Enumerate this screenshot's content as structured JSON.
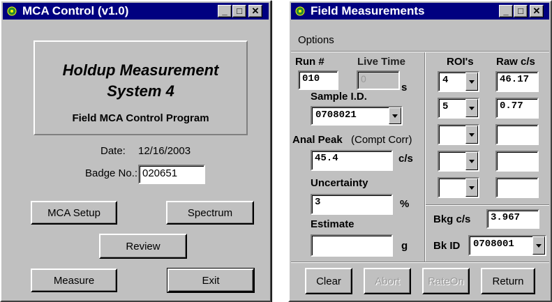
{
  "mca": {
    "title": "MCA Control (v1.0)",
    "banner_line1": "Holdup Measurement",
    "banner_line2": "System 4",
    "banner_sub": "Field MCA Control Program",
    "date_label": "Date:",
    "date_value": "12/16/2003",
    "badge_label": "Badge No.:",
    "badge_value": "020651",
    "buttons": {
      "mca_setup": "MCA Setup",
      "spectrum": "Spectrum",
      "review": "Review",
      "measure": "Measure",
      "exit": "Exit"
    }
  },
  "field": {
    "title": "Field Measurements",
    "menu_options": "Options",
    "run_label": "Run #",
    "run_value": "010",
    "live_time_label": "Live Time",
    "live_time_value": "0",
    "live_time_unit": "s",
    "sample_label": "Sample I.D.",
    "sample_value": "0708021",
    "anal_peak_label": "Anal Peak",
    "anal_peak_sub": "(Compt Corr)",
    "anal_peak_value": "45.4",
    "anal_peak_unit": "c/s",
    "uncertainty_label": "Uncertainty",
    "uncertainty_value": "3",
    "uncertainty_unit": "%",
    "estimate_label": "Estimate",
    "estimate_value": "",
    "estimate_unit": "g",
    "roi_header": "ROI's",
    "raw_header": "Raw c/s",
    "roi_rows": [
      {
        "roi": "4",
        "raw": "46.17"
      },
      {
        "roi": "5",
        "raw": "0.77"
      },
      {
        "roi": "",
        "raw": ""
      },
      {
        "roi": "",
        "raw": ""
      },
      {
        "roi": "",
        "raw": ""
      }
    ],
    "bkg_label": "Bkg c/s",
    "bkg_value": "3.967",
    "bkid_label": "Bk ID",
    "bkid_value": "0708001",
    "buttons": {
      "clear": "Clear",
      "abort": "Abort",
      "rateon": "RateOn",
      "return": "Return"
    }
  },
  "window_controls": {
    "minimize": "_",
    "maximize": "□",
    "close": "✕"
  },
  "colors": {
    "titlebar": "#000080",
    "face": "#c0c0c0"
  }
}
